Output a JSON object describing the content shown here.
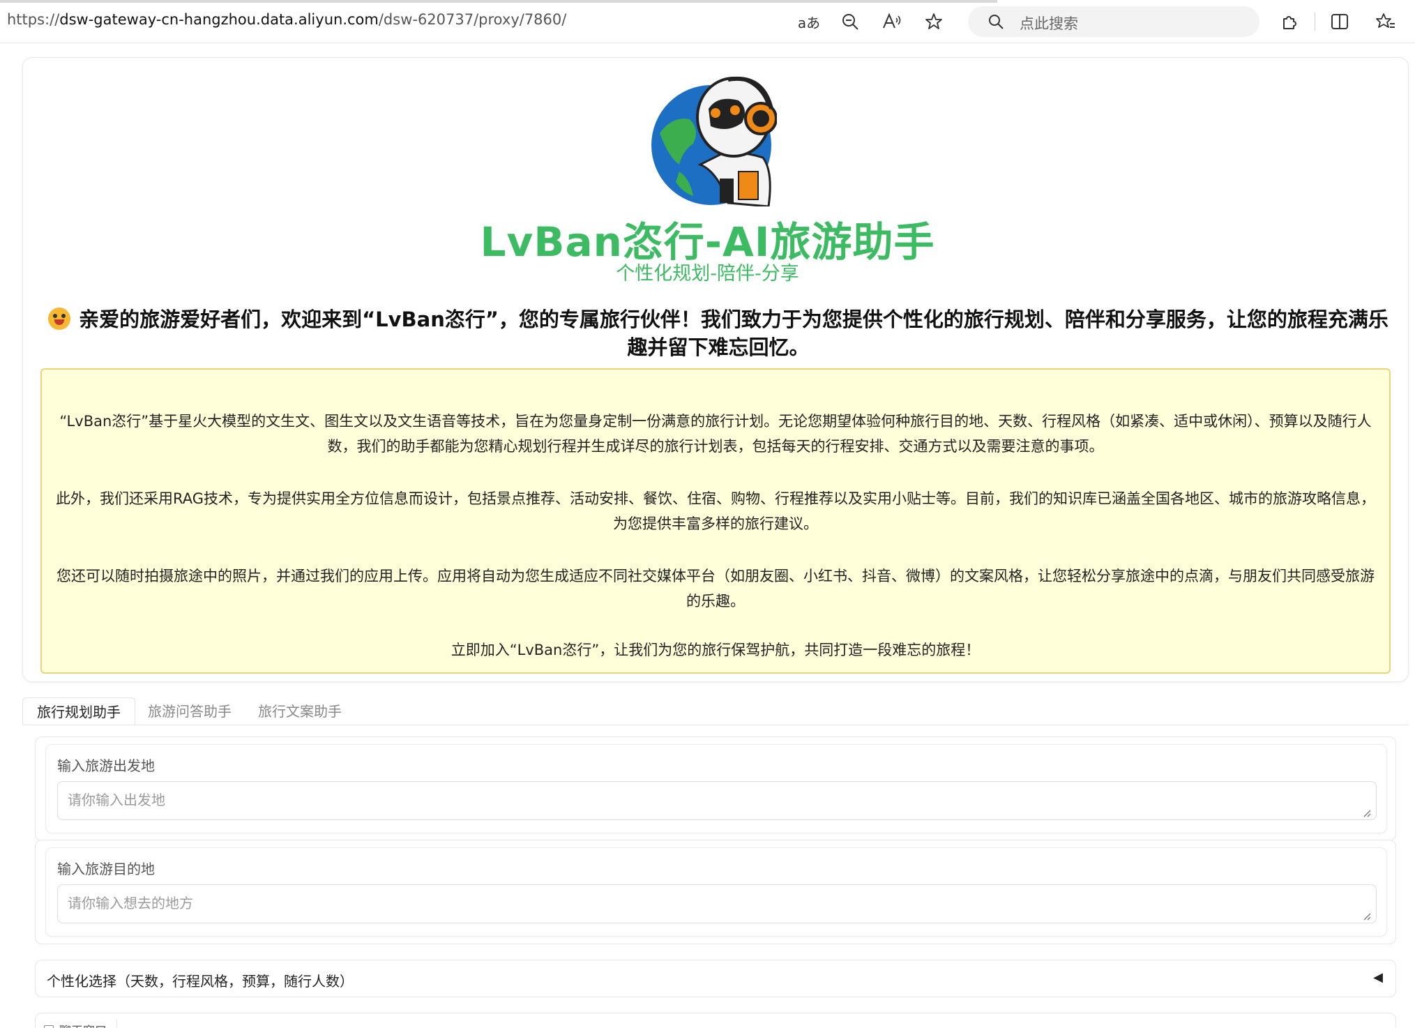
{
  "browser": {
    "url_prefix": "https://",
    "url_host": "dsw-gateway-cn-hangzhou.data.aliyun.com",
    "url_path": "/dsw-620737/proxy/7860/",
    "search_placeholder": "点此搜索",
    "icons": [
      "translate-icon",
      "zoom-out-icon",
      "read-aloud-icon",
      "favorite-star-icon",
      "search-icon",
      "extensions-icon",
      "split-screen-icon",
      "favorites-icon"
    ],
    "translate_glyph": "aあ",
    "read_aloud_glyph": "A))"
  },
  "header": {
    "title": "LvBan恣行-AI旅游助手",
    "subtitle": "个性化规划-陪伴-分享",
    "welcome": "亲爱的旅游爱好者们，欢迎来到“LvBan恣行”，您的专属旅行伙伴！我们致力于为您提供个性化的旅行规划、陪伴和分享服务，让您的旅程充满乐趣并留下难忘回忆。"
  },
  "notice": {
    "p1": "“LvBan恣行”基于星火大模型的文生文、图生文以及文生语音等技术，旨在为您量身定制一份满意的旅行计划。无论您期望体验何种旅行目的地、天数、行程风格（如紧凑、适中或休闲）、预算以及随行人数，我们的助手都能为您精心规划行程并生成详尽的旅行计划表，包括每天的行程安排、交通方式以及需要注意的事项。",
    "p2": "此外，我们还采用RAG技术，专为提供实用全方位信息而设计，包括景点推荐、活动安排、餐饮、住宿、购物、行程推荐以及实用小贴士等。目前，我们的知识库已涵盖全国各地区、城市的旅游攻略信息，为您提供丰富多样的旅行建议。",
    "p3": "您还可以随时拍摄旅途中的照片，并通过我们的应用上传。应用将自动为您生成适应不同社交媒体平台（如朋友圈、小红书、抖音、微博）的文案风格，让您轻松分享旅途中的点滴，与朋友们共同感受旅游的乐趣。",
    "p4": "立即加入“LvBan恣行”，让我们为您的旅行保驾护航，共同打造一段难忘的旅程！"
  },
  "tabs": [
    "旅行规划助手",
    "旅游问答助手",
    "旅行文案助手"
  ],
  "active_tab": "旅行规划助手",
  "form": {
    "origin_label": "输入旅游出发地",
    "origin_placeholder": "请你输入出发地",
    "origin_value": "",
    "destination_label": "输入旅游目的地",
    "destination_placeholder": "请你输入想去的地方",
    "destination_value": "",
    "options_label": "个性化选择（天数，行程风格，预算，随行人数）",
    "options_arrow": "◀",
    "chat_label": "聊天窗口"
  },
  "colors": {
    "brand_green": "#3dbb63",
    "notice_bg": "#ffffd9",
    "notice_border": "#e8d57a"
  }
}
